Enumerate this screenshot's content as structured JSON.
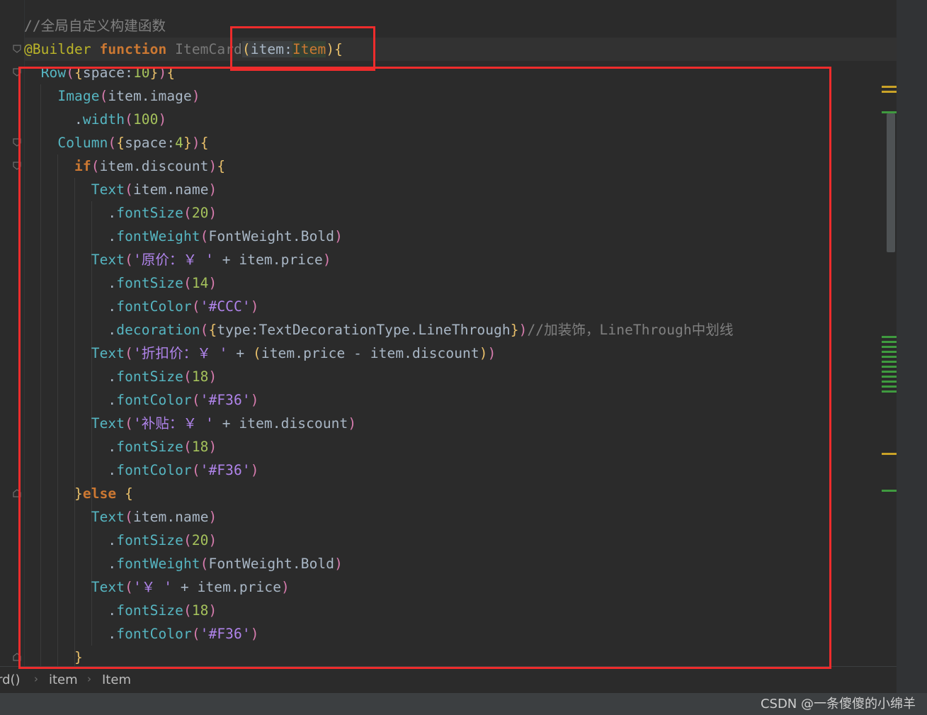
{
  "editor": {
    "lines": [
      {
        "tokens": [
          {
            "t": "//全局自定义构建函数",
            "c": "t-cmt"
          }
        ]
      },
      {
        "tokens": [
          {
            "t": "@Builder",
            "c": "t-ann"
          },
          {
            "t": " ",
            "c": "t-plain"
          },
          {
            "t": "function",
            "c": "t-kw"
          },
          {
            "t": " ",
            "c": "t-plain"
          },
          {
            "t": "ItemCard",
            "c": "t-dim"
          },
          {
            "t": "(",
            "c": "t-p1 hl-bg2"
          },
          {
            "t": "item",
            "c": "t-plain hl-bg2"
          },
          {
            "t": ":",
            "c": "t-plain hl-bg2"
          },
          {
            "t": "Item",
            "c": "t-type hl-bg"
          },
          {
            "t": ")",
            "c": "t-p1"
          },
          {
            "t": "{",
            "c": "t-p1"
          }
        ]
      },
      {
        "tokens": [
          {
            "t": "  ",
            "c": "t-plain"
          },
          {
            "t": "Row",
            "c": "t-comp"
          },
          {
            "t": "(",
            "c": "t-p2"
          },
          {
            "t": "{",
            "c": "t-p1"
          },
          {
            "t": "space",
            "c": "t-plain"
          },
          {
            "t": ":",
            "c": "t-plain"
          },
          {
            "t": "10",
            "c": "t-num2"
          },
          {
            "t": "}",
            "c": "t-p1"
          },
          {
            "t": ")",
            "c": "t-p2"
          },
          {
            "t": "{",
            "c": "t-p1"
          }
        ]
      },
      {
        "tokens": [
          {
            "t": "    ",
            "c": "t-plain"
          },
          {
            "t": "Image",
            "c": "t-comp"
          },
          {
            "t": "(",
            "c": "t-p2"
          },
          {
            "t": "item",
            "c": "t-plain"
          },
          {
            "t": ".",
            "c": "t-plain"
          },
          {
            "t": "image",
            "c": "t-plain"
          },
          {
            "t": ")",
            "c": "t-p2"
          }
        ]
      },
      {
        "tokens": [
          {
            "t": "      .",
            "c": "t-plain"
          },
          {
            "t": "width",
            "c": "t-attr"
          },
          {
            "t": "(",
            "c": "t-p2"
          },
          {
            "t": "100",
            "c": "t-num2"
          },
          {
            "t": ")",
            "c": "t-p2"
          }
        ]
      },
      {
        "tokens": [
          {
            "t": "    ",
            "c": "t-plain"
          },
          {
            "t": "Column",
            "c": "t-comp"
          },
          {
            "t": "(",
            "c": "t-p2"
          },
          {
            "t": "{",
            "c": "t-p1"
          },
          {
            "t": "space",
            "c": "t-plain"
          },
          {
            "t": ":",
            "c": "t-plain"
          },
          {
            "t": "4",
            "c": "t-num2"
          },
          {
            "t": "}",
            "c": "t-p1"
          },
          {
            "t": ")",
            "c": "t-p2"
          },
          {
            "t": "{",
            "c": "t-p1"
          }
        ]
      },
      {
        "tokens": [
          {
            "t": "      ",
            "c": "t-plain"
          },
          {
            "t": "if",
            "c": "t-kw"
          },
          {
            "t": "(",
            "c": "t-p2"
          },
          {
            "t": "item",
            "c": "t-plain"
          },
          {
            "t": ".",
            "c": "t-plain"
          },
          {
            "t": "discount",
            "c": "t-plain"
          },
          {
            "t": ")",
            "c": "t-p2"
          },
          {
            "t": "{",
            "c": "t-p1"
          }
        ]
      },
      {
        "tokens": [
          {
            "t": "        ",
            "c": "t-plain"
          },
          {
            "t": "Text",
            "c": "t-comp"
          },
          {
            "t": "(",
            "c": "t-p2"
          },
          {
            "t": "item",
            "c": "t-plain"
          },
          {
            "t": ".",
            "c": "t-plain"
          },
          {
            "t": "name",
            "c": "t-plain"
          },
          {
            "t": ")",
            "c": "t-p2"
          }
        ]
      },
      {
        "tokens": [
          {
            "t": "          .",
            "c": "t-plain"
          },
          {
            "t": "fontSize",
            "c": "t-attr"
          },
          {
            "t": "(",
            "c": "t-p2"
          },
          {
            "t": "20",
            "c": "t-num2"
          },
          {
            "t": ")",
            "c": "t-p2"
          }
        ]
      },
      {
        "tokens": [
          {
            "t": "          .",
            "c": "t-plain"
          },
          {
            "t": "fontWeight",
            "c": "t-attr"
          },
          {
            "t": "(",
            "c": "t-p2"
          },
          {
            "t": "FontWeight",
            "c": "t-plain"
          },
          {
            "t": ".",
            "c": "t-plain"
          },
          {
            "t": "Bold",
            "c": "t-plain"
          },
          {
            "t": ")",
            "c": "t-p2"
          }
        ]
      },
      {
        "tokens": [
          {
            "t": "        ",
            "c": "t-plain"
          },
          {
            "t": "Text",
            "c": "t-comp"
          },
          {
            "t": "(",
            "c": "t-p2"
          },
          {
            "t": "'原价：￥ '",
            "c": "t-strv"
          },
          {
            "t": " + ",
            "c": "t-plain"
          },
          {
            "t": "item",
            "c": "t-plain"
          },
          {
            "t": ".",
            "c": "t-plain"
          },
          {
            "t": "price",
            "c": "t-plain"
          },
          {
            "t": ")",
            "c": "t-p2"
          }
        ]
      },
      {
        "tokens": [
          {
            "t": "          .",
            "c": "t-plain"
          },
          {
            "t": "fontSize",
            "c": "t-attr"
          },
          {
            "t": "(",
            "c": "t-p2"
          },
          {
            "t": "14",
            "c": "t-num2"
          },
          {
            "t": ")",
            "c": "t-p2"
          }
        ]
      },
      {
        "tokens": [
          {
            "t": "          .",
            "c": "t-plain"
          },
          {
            "t": "fontColor",
            "c": "t-attr"
          },
          {
            "t": "(",
            "c": "t-p2"
          },
          {
            "t": "'#CCC'",
            "c": "t-strv"
          },
          {
            "t": ")",
            "c": "t-p2"
          }
        ]
      },
      {
        "tokens": [
          {
            "t": "          .",
            "c": "t-plain"
          },
          {
            "t": "decoration",
            "c": "t-attr"
          },
          {
            "t": "(",
            "c": "t-p2"
          },
          {
            "t": "{",
            "c": "t-p1"
          },
          {
            "t": "type",
            "c": "t-plain"
          },
          {
            "t": ":",
            "c": "t-plain"
          },
          {
            "t": "TextDecorationType",
            "c": "t-plain"
          },
          {
            "t": ".",
            "c": "t-plain"
          },
          {
            "t": "LineThrough",
            "c": "t-plain"
          },
          {
            "t": "}",
            "c": "t-p1"
          },
          {
            "t": ")",
            "c": "t-p2"
          },
          {
            "t": "//加装饰，LineThrough中划线",
            "c": "t-cmt"
          }
        ]
      },
      {
        "tokens": [
          {
            "t": "        ",
            "c": "t-plain"
          },
          {
            "t": "Text",
            "c": "t-comp"
          },
          {
            "t": "(",
            "c": "t-p2"
          },
          {
            "t": "'折扣价：￥ '",
            "c": "t-strv"
          },
          {
            "t": " + ",
            "c": "t-plain"
          },
          {
            "t": "(",
            "c": "t-p1"
          },
          {
            "t": "item",
            "c": "t-plain"
          },
          {
            "t": ".",
            "c": "t-plain"
          },
          {
            "t": "price - item",
            "c": "t-plain"
          },
          {
            "t": ".",
            "c": "t-plain"
          },
          {
            "t": "discount",
            "c": "t-plain"
          },
          {
            "t": ")",
            "c": "t-p1"
          },
          {
            "t": ")",
            "c": "t-p2"
          }
        ]
      },
      {
        "tokens": [
          {
            "t": "          .",
            "c": "t-plain"
          },
          {
            "t": "fontSize",
            "c": "t-attr"
          },
          {
            "t": "(",
            "c": "t-p2"
          },
          {
            "t": "18",
            "c": "t-num2"
          },
          {
            "t": ")",
            "c": "t-p2"
          }
        ]
      },
      {
        "tokens": [
          {
            "t": "          .",
            "c": "t-plain"
          },
          {
            "t": "fontColor",
            "c": "t-attr"
          },
          {
            "t": "(",
            "c": "t-p2"
          },
          {
            "t": "'#F36'",
            "c": "t-strv"
          },
          {
            "t": ")",
            "c": "t-p2"
          }
        ]
      },
      {
        "tokens": [
          {
            "t": "        ",
            "c": "t-plain"
          },
          {
            "t": "Text",
            "c": "t-comp"
          },
          {
            "t": "(",
            "c": "t-p2"
          },
          {
            "t": "'补贴：￥ '",
            "c": "t-strv"
          },
          {
            "t": " + ",
            "c": "t-plain"
          },
          {
            "t": "item",
            "c": "t-plain"
          },
          {
            "t": ".",
            "c": "t-plain"
          },
          {
            "t": "discount",
            "c": "t-plain"
          },
          {
            "t": ")",
            "c": "t-p2"
          }
        ]
      },
      {
        "tokens": [
          {
            "t": "          .",
            "c": "t-plain"
          },
          {
            "t": "fontSize",
            "c": "t-attr"
          },
          {
            "t": "(",
            "c": "t-p2"
          },
          {
            "t": "18",
            "c": "t-num2"
          },
          {
            "t": ")",
            "c": "t-p2"
          }
        ]
      },
      {
        "tokens": [
          {
            "t": "          .",
            "c": "t-plain"
          },
          {
            "t": "fontColor",
            "c": "t-attr"
          },
          {
            "t": "(",
            "c": "t-p2"
          },
          {
            "t": "'#F36'",
            "c": "t-strv"
          },
          {
            "t": ")",
            "c": "t-p2"
          }
        ]
      },
      {
        "tokens": [
          {
            "t": "      ",
            "c": "t-plain"
          },
          {
            "t": "}",
            "c": "t-p1"
          },
          {
            "t": "else",
            "c": "t-kw"
          },
          {
            "t": " ",
            "c": "t-plain"
          },
          {
            "t": "{",
            "c": "t-p1"
          }
        ]
      },
      {
        "tokens": [
          {
            "t": "        ",
            "c": "t-plain"
          },
          {
            "t": "Text",
            "c": "t-comp"
          },
          {
            "t": "(",
            "c": "t-p2"
          },
          {
            "t": "item",
            "c": "t-plain"
          },
          {
            "t": ".",
            "c": "t-plain"
          },
          {
            "t": "name",
            "c": "t-plain"
          },
          {
            "t": ")",
            "c": "t-p2"
          }
        ]
      },
      {
        "tokens": [
          {
            "t": "          .",
            "c": "t-plain"
          },
          {
            "t": "fontSize",
            "c": "t-attr"
          },
          {
            "t": "(",
            "c": "t-p2"
          },
          {
            "t": "20",
            "c": "t-num2"
          },
          {
            "t": ")",
            "c": "t-p2"
          }
        ]
      },
      {
        "tokens": [
          {
            "t": "          .",
            "c": "t-plain"
          },
          {
            "t": "fontWeight",
            "c": "t-attr"
          },
          {
            "t": "(",
            "c": "t-p2"
          },
          {
            "t": "FontWeight",
            "c": "t-plain"
          },
          {
            "t": ".",
            "c": "t-plain"
          },
          {
            "t": "Bold",
            "c": "t-plain"
          },
          {
            "t": ")",
            "c": "t-p2"
          }
        ]
      },
      {
        "tokens": [
          {
            "t": "        ",
            "c": "t-plain"
          },
          {
            "t": "Text",
            "c": "t-comp"
          },
          {
            "t": "(",
            "c": "t-p2"
          },
          {
            "t": "'￥ '",
            "c": "t-strv"
          },
          {
            "t": " + ",
            "c": "t-plain"
          },
          {
            "t": "item",
            "c": "t-plain"
          },
          {
            "t": ".",
            "c": "t-plain"
          },
          {
            "t": "price",
            "c": "t-plain"
          },
          {
            "t": ")",
            "c": "t-p2"
          }
        ]
      },
      {
        "tokens": [
          {
            "t": "          .",
            "c": "t-plain"
          },
          {
            "t": "fontSize",
            "c": "t-attr"
          },
          {
            "t": "(",
            "c": "t-p2"
          },
          {
            "t": "18",
            "c": "t-num2"
          },
          {
            "t": ")",
            "c": "t-p2"
          }
        ]
      },
      {
        "tokens": [
          {
            "t": "          .",
            "c": "t-plain"
          },
          {
            "t": "fontColor",
            "c": "t-attr"
          },
          {
            "t": "(",
            "c": "t-p2"
          },
          {
            "t": "'#F36'",
            "c": "t-strv"
          },
          {
            "t": ")",
            "c": "t-p2"
          }
        ]
      },
      {
        "tokens": [
          {
            "t": "      ",
            "c": "t-plain"
          },
          {
            "t": "}",
            "c": "t-p1"
          }
        ]
      }
    ]
  },
  "breadcrumb": {
    "items": [
      "rd()",
      "item",
      "Item"
    ],
    "separator_icon": "chevron-right-icon"
  },
  "watermark": {
    "text": "CSDN @一条傻傻的小绵羊"
  },
  "colors": {
    "highlight_box": "#ee2c2c",
    "editor_bg": "#2b2b2b",
    "warning_marker": "#c9a227",
    "ok_marker": "#3f9a3f"
  }
}
